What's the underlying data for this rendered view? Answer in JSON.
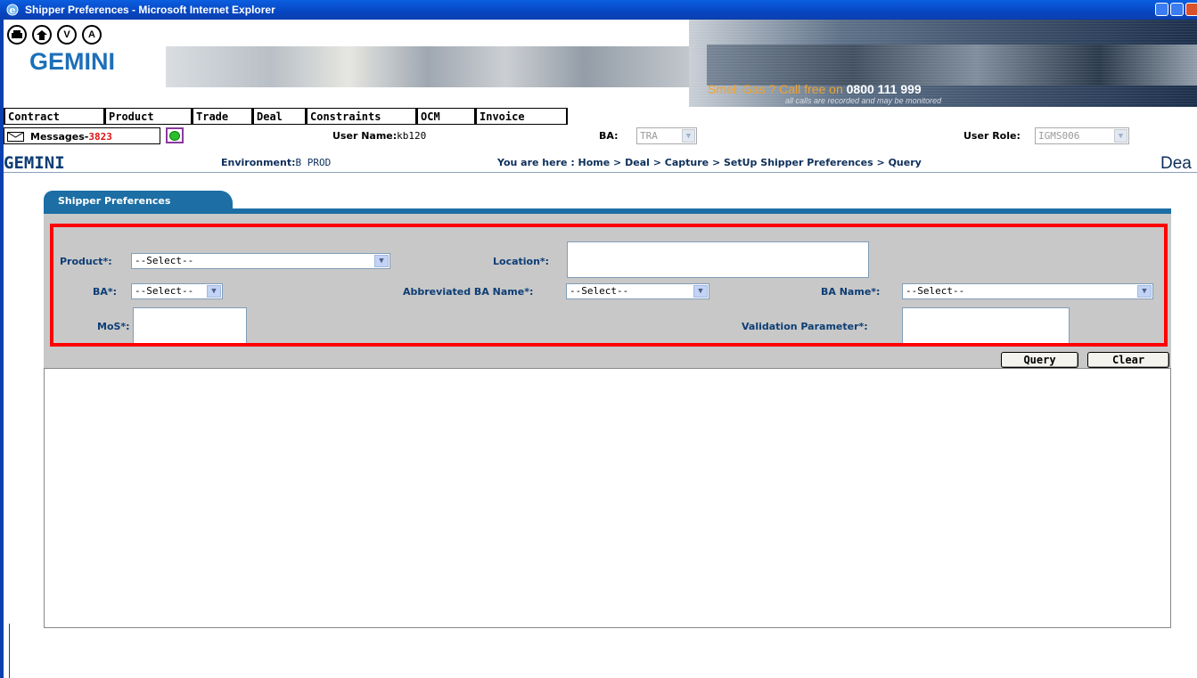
{
  "window": {
    "title": "Shipper Preferences - Microsoft Internet Explorer"
  },
  "header": {
    "nav_icons": [
      "print-icon",
      "home-icon",
      "V",
      "A"
    ],
    "logo": "GEMINI",
    "banner_text": "Smell Gas ? Call free on",
    "banner_phone": "0800 111 999",
    "banner_sub": "all calls are recorded and may be monitored"
  },
  "menu": [
    "Contract",
    "Product",
    "Trade",
    "Deal",
    "Constraints",
    "OCM",
    "Invoice"
  ],
  "info": {
    "messages_label": "Messages-",
    "messages_count": "3823",
    "user_name_label": "User Name:",
    "user_name": "kb120",
    "ba_label": "BA:",
    "ba_value": "TRA",
    "user_role_label": "User Role:",
    "user_role": "IGMS006"
  },
  "location": {
    "logo": "GEMINI",
    "environment_label": "Environment:",
    "environment": "B PROD",
    "breadcrumb": "You are here : Home > Deal > Capture > SetUp Shipper Preferences > Query",
    "page_title_partial": "Dea"
  },
  "tab": {
    "label": "Shipper Preferences"
  },
  "form": {
    "product_label": "Product*:",
    "product_value": "--Select--",
    "location_label": "Location*:",
    "ba_label": "BA*:",
    "ba_value": "--Select--",
    "abbr_ba_label": "Abbreviated BA Name*:",
    "abbr_ba_value": "--Select--",
    "ba_name_label": "BA Name*:",
    "ba_name_value": "--Select--",
    "mos_label": "MoS*:",
    "validation_label": "Validation Parameter*:"
  },
  "buttons": {
    "query": "Query",
    "clear": "Clear"
  },
  "colors": {
    "accent": "#1c6ea5",
    "highlight": "#ff0000",
    "panel": "#c8c8c8",
    "logo": "#1d6fb8"
  }
}
